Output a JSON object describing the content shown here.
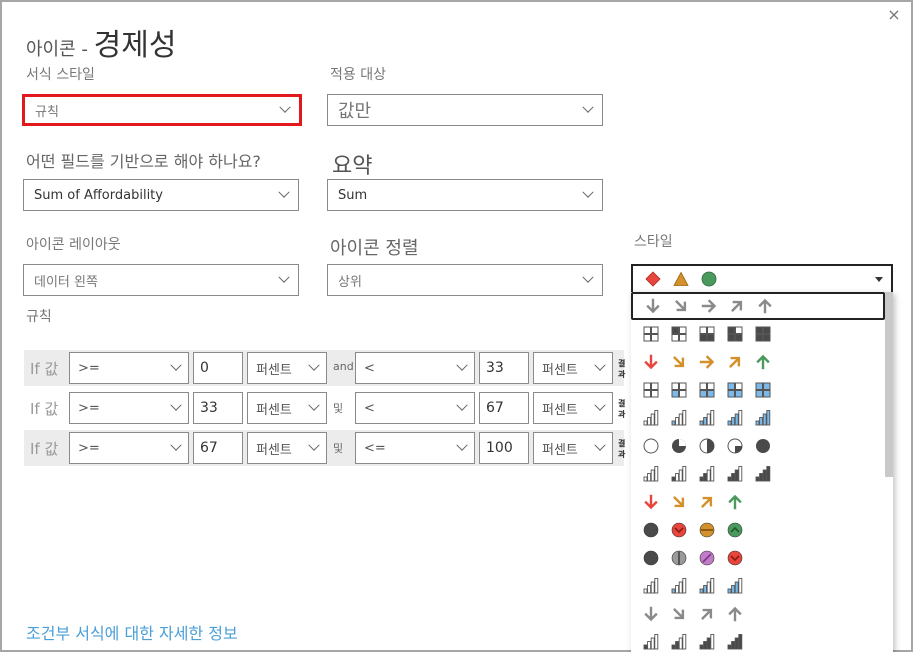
{
  "dialog": {
    "title_prefix": "아이콘 - ",
    "title_main": "경제성",
    "close_label": "×"
  },
  "form": {
    "format_style_label": "서식 스타일",
    "format_style_value": "규칙",
    "apply_to_label": "적용 대상",
    "apply_to_value": "값만",
    "based_on_field_label": "어떤 필드를 기반으로 해야 하나요?",
    "based_on_field_value": "Sum of Affordability",
    "summarization_label": "요약",
    "summarization_value": "Sum",
    "icon_layout_label": "아이콘 레이아웃",
    "icon_layout_value": "데이터 왼쪽",
    "icon_alignment_label": "아이콘 정렬",
    "icon_alignment_value": "상위",
    "style_label": "스타일",
    "rules_label": "규칙"
  },
  "rules": [
    {
      "if_label": "If 값",
      "op1": ">=",
      "val1": "0",
      "unit1": "퍼센트",
      "connector": "and",
      "op2": "<",
      "val2": "33",
      "unit2": "퍼센트",
      "result_label": "결과"
    },
    {
      "if_label": "If 값",
      "op1": ">=",
      "val1": "33",
      "unit1": "퍼센트",
      "connector": "및",
      "op2": "<",
      "val2": "67",
      "unit2": "퍼센트",
      "result_label": "결과"
    },
    {
      "if_label": "If 값",
      "op1": ">=",
      "val1": "67",
      "unit1": "퍼센트",
      "connector": "및",
      "op2": "<=",
      "val2": "100",
      "unit2": "퍼센트",
      "result_label": "결과"
    }
  ],
  "style_dropdown": {
    "selected_icons": [
      "red-diamond",
      "orange-triangle",
      "green-circle"
    ],
    "options": [
      {
        "name": "gray-arrows-5",
        "icons": [
          "arrow-down-gray",
          "arrow-down-right-gray",
          "arrow-right-gray",
          "arrow-up-right-gray",
          "arrow-up-gray"
        ]
      },
      {
        "name": "quarters-dark-5",
        "icons": [
          "grid-0",
          "grid-1",
          "grid-2",
          "grid-3",
          "grid-4"
        ]
      },
      {
        "name": "colored-arrows-5",
        "icons": [
          "arrow-down-red",
          "arrow-down-right-orange",
          "arrow-right-orange",
          "arrow-up-right-orange",
          "arrow-up-green"
        ]
      },
      {
        "name": "quarters-blue-5",
        "icons": [
          "bgrid-0",
          "bgrid-1",
          "bgrid-2",
          "bgrid-3",
          "bgrid-4"
        ]
      },
      {
        "name": "signal-blue-5",
        "icons": [
          "bsig-0",
          "bsig-1",
          "bsig-2",
          "bsig-3",
          "bsig-4"
        ]
      },
      {
        "name": "pies-5",
        "icons": [
          "pie-0",
          "pie-3q",
          "pie-half",
          "pie-1q",
          "pie-full"
        ]
      },
      {
        "name": "signal-dark-5",
        "icons": [
          "dsig-0",
          "dsig-1",
          "dsig-2",
          "dsig-3",
          "dsig-4"
        ]
      },
      {
        "name": "colored-arrows-4",
        "icons": [
          "arrow-down-red",
          "arrow-down-right-orange",
          "arrow-up-right-orange",
          "arrow-up-green"
        ]
      },
      {
        "name": "circles-chevrons-4",
        "icons": [
          "circle-dark",
          "circle-red-down",
          "circle-orange-minus",
          "circle-green-up"
        ]
      },
      {
        "name": "circles-symbols-4",
        "icons": [
          "circle-dark",
          "circle-gray-bar",
          "circle-purple-slash",
          "circle-red-down"
        ]
      },
      {
        "name": "signal-blue-4",
        "icons": [
          "bsig4-0",
          "bsig4-1",
          "bsig4-2",
          "bsig4-3"
        ]
      },
      {
        "name": "gray-arrows-4",
        "icons": [
          "arrow-down-gray",
          "arrow-down-right-gray",
          "arrow-up-right-gray",
          "arrow-up-gray"
        ]
      },
      {
        "name": "signal-dark-4",
        "icons": [
          "dsig4-1",
          "dsig4-2",
          "dsig4-3",
          "dsig4-4"
        ]
      }
    ]
  },
  "colors": {
    "highlight_border": "#e1181c",
    "link": "#4a9fd8",
    "red": "#e8453c",
    "orange": "#d4902a",
    "green": "#4a9a5e",
    "blue": "#7cb9e8",
    "dark": "#4a4a4a",
    "gray": "#8a8a8a",
    "purple": "#c27bc9"
  },
  "footer": {
    "learn_more_link": "조건부 서식에 대한 자세한 정보"
  }
}
